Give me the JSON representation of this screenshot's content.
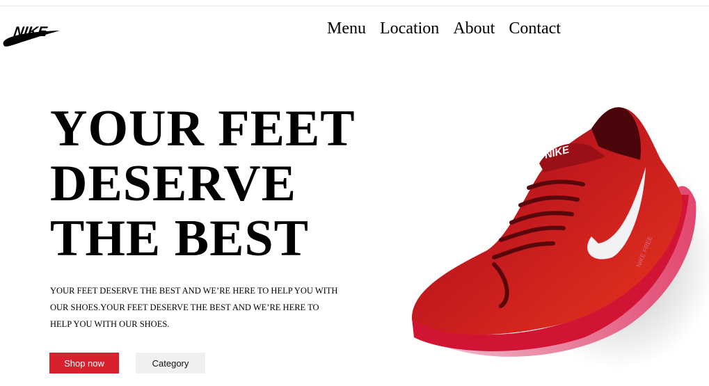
{
  "brand": {
    "logo_text": "NIKE",
    "accent": "#d9212d"
  },
  "nav": {
    "items": [
      "Menu",
      "Location",
      "About",
      "Contact"
    ]
  },
  "hero": {
    "headline_lines": [
      "YOUR FEET",
      "DESERVE",
      "THE BEST"
    ],
    "description": "YOUR FEET DESERVE THE BEST AND WE’RE HERE TO HELP YOU WITH OUR SHOES.YOUR FEET DESERVE THE BEST AND WE’RE HERE TO HELP YOU WITH OUR SHOES.",
    "shop_label": "Shop now",
    "category_label": "Category"
  },
  "shoe": {
    "tongue_text": "NIKE",
    "side_text": "NIKE FREE",
    "icon": "red-running-shoe"
  }
}
